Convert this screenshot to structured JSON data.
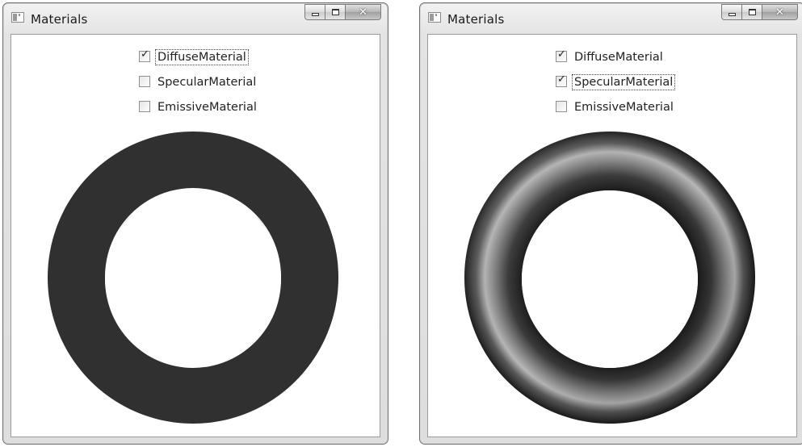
{
  "windows": [
    {
      "title": "Materials",
      "checkboxes": [
        {
          "label": "DiffuseMaterial",
          "checked": true,
          "focused": true
        },
        {
          "label": "SpecularMaterial",
          "checked": false,
          "focused": false
        },
        {
          "label": "EmissiveMaterial",
          "checked": false,
          "focused": false
        }
      ]
    },
    {
      "title": "Materials",
      "checkboxes": [
        {
          "label": "DiffuseMaterial",
          "checked": true,
          "focused": false
        },
        {
          "label": "SpecularMaterial",
          "checked": true,
          "focused": true
        },
        {
          "label": "EmissiveMaterial",
          "checked": false,
          "focused": false
        }
      ]
    }
  ],
  "check_glyph": "✓",
  "colors": {
    "torus": "#2f2f2f",
    "specular_highlight": "#c8c8c8"
  }
}
